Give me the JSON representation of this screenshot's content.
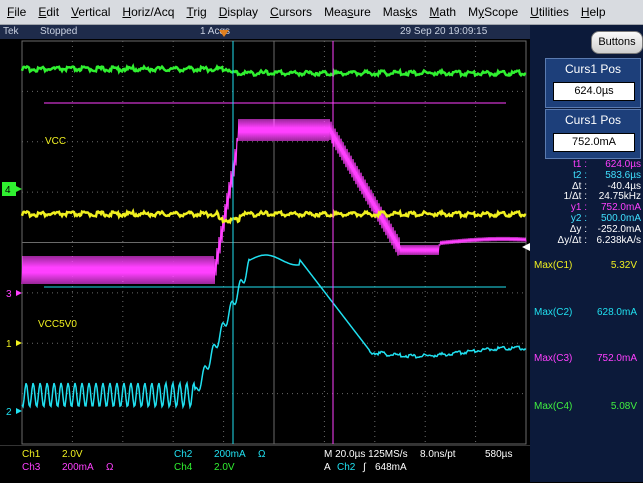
{
  "menu": [
    "File",
    "Edit",
    "Vertical",
    "Horiz/Acq",
    "Trig",
    "Display",
    "Cursors",
    "Measure",
    "Masks",
    "Math",
    "MyScope",
    "Utilities",
    "Help"
  ],
  "menu_underline": [
    "F",
    "E",
    "V",
    "H",
    "T",
    "D",
    "C",
    "s",
    "k",
    "M",
    "y",
    "U",
    "H"
  ],
  "status": {
    "brand": "Tek",
    "state": "Stopped",
    "acqs": "1 Acqs",
    "datetime": "29 Sep 20 19:09:15"
  },
  "buttons_label": "Buttons",
  "curs1_pos_a": {
    "title": "Curs1 Pos",
    "value": "624.0µs"
  },
  "curs1_pos_b": {
    "title": "Curs1 Pos",
    "value": "752.0mA"
  },
  "readouts": [
    {
      "label": "t1 :",
      "value": "624.0µs",
      "color": "#ff40ff"
    },
    {
      "label": "t2 :",
      "value": "583.6µs",
      "color": "#40e0ff"
    },
    {
      "label": "Δt :",
      "value": "-40.4µs",
      "color": "#ffffff"
    },
    {
      "label": "1/Δt :",
      "value": "24.75kHz",
      "color": "#ffffff"
    },
    {
      "label": "y1 :",
      "value": "752.0mA",
      "color": "#ff40ff"
    },
    {
      "label": "y2 :",
      "value": "500.0mA",
      "color": "#40e0ff"
    },
    {
      "label": "Δy :",
      "value": "-252.0mA",
      "color": "#ffffff"
    },
    {
      "label": "Δy/Δt :",
      "value": "6.238kA/s",
      "color": "#ffffff"
    }
  ],
  "measurements": [
    {
      "label": "Max(C1)",
      "value": "5.32V",
      "color": "#f0f020"
    },
    {
      "label": "Max(C2)",
      "value": "628.0mA",
      "color": "#20e0f0"
    },
    {
      "label": "Max(C3)",
      "value": "752.0mA",
      "color": "#ff40ff"
    },
    {
      "label": "Max(C4)",
      "value": "5.08V",
      "color": "#40f040"
    }
  ],
  "waveform_labels": {
    "vcc": "VCC",
    "vcc5v0": "VCC5V0"
  },
  "markers": {
    "ch4": "4",
    "ch3": "3",
    "ch1": "1",
    "ch2": "2"
  },
  "bottom": {
    "ch1": "Ch1",
    "ch1_scale": "2.0V",
    "ch3": "Ch3",
    "ch3_scale": "200mA",
    "ch3_unit": "Ω",
    "ch2": "Ch2",
    "ch2_scale": "200mA",
    "ch2_unit": "Ω",
    "ch4": "Ch4",
    "ch4_scale": "2.0V",
    "timebase": "M 20.0µs 125MS/s",
    "rate": "8.0ns/pt",
    "trigpos": "580µs",
    "trig": "A",
    "trig_src": "Ch2",
    "trig_slope": "∫",
    "trig_level": "648mA"
  },
  "colors": {
    "ch1": "#f0f020",
    "ch2": "#20e0f0",
    "ch3": "#ff40ff",
    "ch4": "#30f030",
    "grid": "#6a6a6a"
  }
}
